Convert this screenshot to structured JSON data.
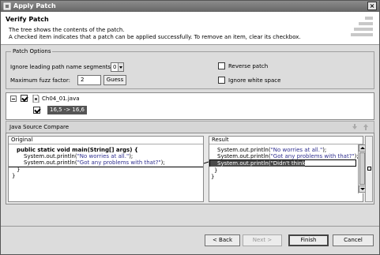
{
  "window": {
    "title": "Apply Patch",
    "close_glyph": "×"
  },
  "header": {
    "title": "Verify Patch",
    "line1": "The tree shows the contents of the patch.",
    "line2": "A checked item indicates that a patch can be applied successfully. To remove an item, clear its checkbox."
  },
  "patch_options": {
    "legend": "Patch Options",
    "ignore_segments_label": "Ignore leading path name segments:",
    "ignore_segments_value": "0",
    "fuzz_label": "Maximum fuzz factor:",
    "fuzz_value": "2",
    "guess_button": "Guess",
    "reverse_label": "Reverse patch",
    "reverse_checked": false,
    "ignore_ws_label": "Ignore white space",
    "ignore_ws_checked": false
  },
  "tree": {
    "file": "Ch04_01.java",
    "file_checked": true,
    "hunk": "16,5 -> 16,6",
    "hunk_checked": true
  },
  "compare": {
    "title": "Java Source Compare",
    "original_header": "Original",
    "result_header": "Result",
    "original_lines": {
      "l1_kw": "public static void main(String[] args) {",
      "l2_pre": "System.out.println(",
      "l2_str": "\"No worries at all.\"",
      "l2_post": ");",
      "l3_pre": "System.out.println(",
      "l3_str": "\"Got any problems with that?\"",
      "l3_post": ");",
      "l4": "}",
      "l5": "}"
    },
    "result_lines": {
      "l1_pre": "System.out.println(",
      "l1_str": "\"No worries at all.\"",
      "l1_post": ");",
      "l2_pre": "System.out.println(",
      "l2_str": "\"Got any problems with that?\"",
      "l2_post": ");",
      "l3": "System.out.println(\"Didn't think so.\");",
      "l4": "}",
      "l5": "}"
    }
  },
  "buttons": {
    "back": "< Back",
    "next": "Next >",
    "finish": "Finish",
    "cancel": "Cancel"
  },
  "icons": {
    "window_icon": "patch-icon",
    "file_icon": "java-file-icon",
    "nav_up": "up-arrow-icon",
    "nav_down": "down-arrow-icon"
  }
}
